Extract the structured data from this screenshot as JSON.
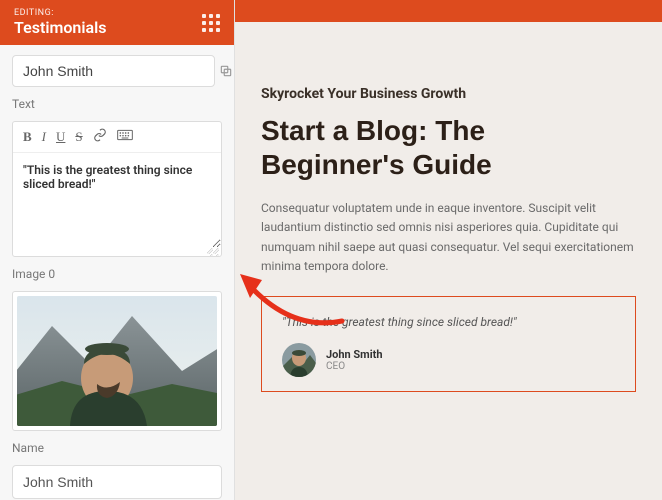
{
  "sidebar": {
    "editing_label": "EDITING:",
    "module_title": "Testimonials",
    "title_value": "John Smith",
    "text_label": "Text",
    "text_value": "\"This is the greatest thing since sliced bread!\"",
    "image_label": "Image 0",
    "name_label": "Name",
    "name_value": "John Smith"
  },
  "toolbar": {
    "bold": "B",
    "italic": "I",
    "underline": "U",
    "strike": "S"
  },
  "preview": {
    "eyebrow": "Skyrocket Your Business Growth",
    "headline": "Start a Blog: The Beginner's Guide",
    "lede": "Consequatur voluptatem unde in eaque inventore. Suscipit velit laudantium distinctio sed omnis nisi asperiores quia. Cupiditate qui numquam nihil saepe aut quasi consequatur. Vel sequi exercitationem minima tempora dolore.",
    "quote": "\"This is the greatest thing since sliced bread!\"",
    "author_name": "John Smith",
    "author_role": "CEO"
  },
  "colors": {
    "accent": "#dd4b1e"
  }
}
